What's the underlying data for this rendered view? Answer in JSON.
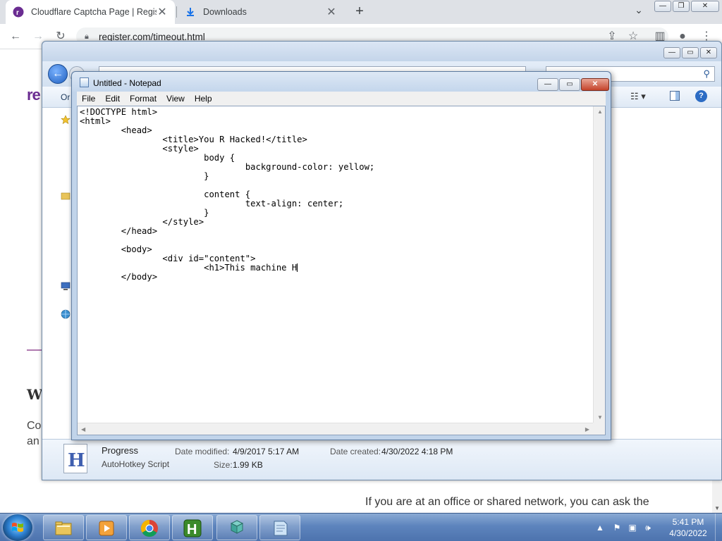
{
  "browser": {
    "tabs": [
      {
        "title": "Cloudflare Captcha Page | Regist",
        "close": "✕"
      },
      {
        "title": "Downloads",
        "close": "✕"
      }
    ],
    "new_tab": "+",
    "url": "register.com/timeout.html",
    "page": {
      "logo_text": "re",
      "heading_fragment": "W",
      "para1_fragment": "Co",
      "para2_fragment": "an",
      "bottom_text": "If you are at an office or shared network, you can ask the"
    }
  },
  "explorer": {
    "organize_fragment": "Or",
    "details": {
      "icon_letter": "H",
      "file_name": "Progress",
      "file_type": "AutoHotkey Script",
      "modified_label": "Date modified:",
      "modified_value": "4/9/2017 5:17 AM",
      "created_label": "Date created:",
      "created_value": "4/30/2022 4:18 PM",
      "size_label": "Size:",
      "size_value": "1.99 KB"
    }
  },
  "notepad": {
    "title": "Untitled - Notepad",
    "menu": [
      "File",
      "Edit",
      "Format",
      "View",
      "Help"
    ],
    "content": "<!DOCTYPE html>\n<html>\n\t<head>\n\t\t<title>You R Hacked!</title>\n\t\t<style>\n\t\t\tbody {\n\t\t\t\tbackground-color: yellow;\n\t\t\t}\n\n\t\t\tcontent {\n\t\t\t\ttext-align: center;\n\t\t\t}\n\t\t</style>\n\t</head>\n\n\t<body>\n\t\t<div id=\"content\">\n\t\t\t<h1>This machine H",
    "content_tail": "\n\t</body>"
  },
  "taskbar": {
    "time": "5:41 PM",
    "date": "4/30/2022",
    "tray_expand": "▲"
  },
  "colors": {
    "taskbar": "#5d84bd",
    "notepad_frame": "#c1d4ea",
    "close_button": "#c4432a",
    "site_brand": "#6a2c91"
  }
}
